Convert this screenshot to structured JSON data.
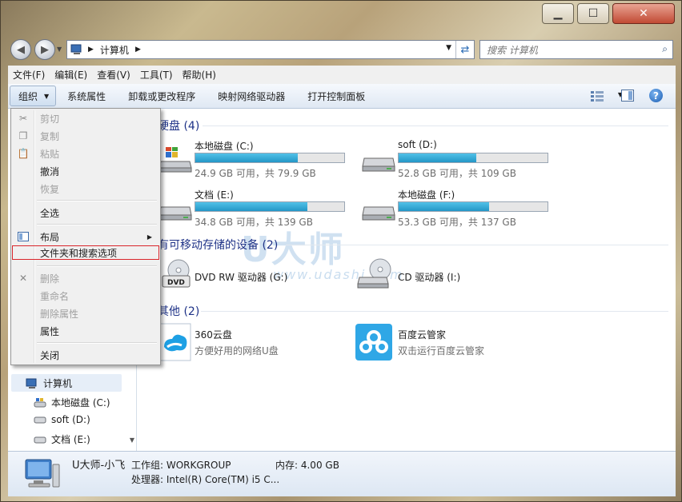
{
  "window": {
    "buttons": {
      "minimize": "▁",
      "maximize": "☐",
      "close": "✕"
    }
  },
  "address": {
    "path": "计算机",
    "search_placeholder": "搜索 计算机"
  },
  "menubar": [
    "文件(F)",
    "编辑(E)",
    "查看(V)",
    "工具(T)",
    "帮助(H)"
  ],
  "toolbar": {
    "organize": "组织",
    "items": [
      "系统属性",
      "卸载或更改程序",
      "映射网络驱动器",
      "打开控制面板"
    ]
  },
  "context_menu": {
    "items": [
      {
        "label": "剪切",
        "disabled": true
      },
      {
        "label": "复制",
        "disabled": true
      },
      {
        "label": "粘贴",
        "disabled": true
      },
      {
        "label": "撤消",
        "disabled": false
      },
      {
        "label": "恢复",
        "disabled": true
      },
      {
        "label": "全选",
        "disabled": false
      },
      {
        "label": "布局",
        "disabled": false
      },
      {
        "label": "文件夹和搜索选项",
        "disabled": false
      },
      {
        "label": "删除",
        "disabled": true
      },
      {
        "label": "重命名",
        "disabled": true
      },
      {
        "label": "删除属性",
        "disabled": true
      },
      {
        "label": "属性",
        "disabled": false
      },
      {
        "label": "关闭",
        "disabled": false
      }
    ]
  },
  "groups": {
    "hdd": "硬盘 (4)",
    "removable": "有可移动存储的设备 (2)",
    "other": "其他 (2)"
  },
  "drives": [
    {
      "name": "本地磁盘 (C:)",
      "info": "24.9 GB 可用，共 79.9 GB",
      "used_fraction": 0.69
    },
    {
      "name": "soft (D:)",
      "info": "52.8 GB 可用，共 109 GB",
      "used_fraction": 0.52
    },
    {
      "name": "文档 (E:)",
      "info": "34.8 GB 可用，共 139 GB",
      "used_fraction": 0.75
    },
    {
      "name": "本地磁盘 (F:)",
      "info": "53.3 GB 可用，共 137 GB",
      "used_fraction": 0.61
    }
  ],
  "removable": [
    {
      "name": "DVD RW 驱动器 (G:)",
      "icon": "dvd-drive-icon"
    },
    {
      "name": "CD 驱动器 (I:)",
      "icon": "cd-drive-icon"
    }
  ],
  "other": [
    {
      "name": "360云盘",
      "desc": "方便好用的网络U盘",
      "icon": "360-cloud-icon"
    },
    {
      "name": "百度云管家",
      "desc": "双击运行百度云管家",
      "icon": "baidu-cloud-icon"
    }
  ],
  "watermark": {
    "brand": "U大师",
    "url": "www.udashi.com"
  },
  "nav_tree": [
    {
      "label": "计算机"
    },
    {
      "label": "本地磁盘 (C:)"
    },
    {
      "label": "soft (D:)"
    },
    {
      "label": "文档 (E:)"
    }
  ],
  "status": {
    "computer_name": "U大师-小飞",
    "workgroup": "工作组: WORKGROUP",
    "memory": "内存: 4.00 GB",
    "processor": "处理器: Intel(R) Core(TM) i5 C..."
  },
  "colors": {
    "accent_bar": "#2496c6",
    "group_header": "#1e3287",
    "highlight_box": "#d9252a"
  }
}
